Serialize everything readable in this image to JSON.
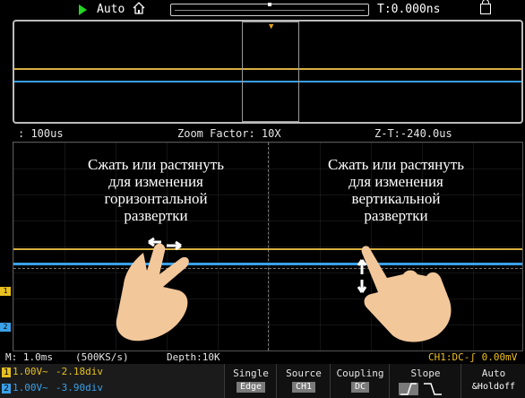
{
  "top_bar": {
    "mode": "Auto",
    "trigger_time": "T:0.000ns"
  },
  "zoom_info": {
    "left": ": 100us",
    "factor": "Zoom Factor: 10X",
    "ztime": "Z-T:-240.0us"
  },
  "hints": {
    "left": [
      "Сжать или растянуть",
      "для изменения",
      "горизонтальной",
      "развертки"
    ],
    "right": [
      "Сжать или растянуть",
      "для изменения",
      "вертикальной",
      "развертки"
    ]
  },
  "status": {
    "time": "M: 1.0ms",
    "rate": "(500KS/s)",
    "depth": "Depth:10K",
    "trigger": "CH1:DC-ʃ 0.00mV"
  },
  "channels": [
    {
      "num": "1",
      "volt": "1.00V~",
      "pos": "-2.18div"
    },
    {
      "num": "2",
      "volt": "1.00V~",
      "pos": "-3.90div"
    }
  ],
  "softkeys": {
    "single": {
      "label": "Single",
      "value": "Edge"
    },
    "source": {
      "label": "Source",
      "value": "CH1"
    },
    "coupling": {
      "label": "Coupling",
      "value": "DC"
    },
    "slope": {
      "label": "Slope"
    },
    "auto": {
      "label": "Auto",
      "value": "&Holdoff"
    }
  },
  "colors": {
    "ch1": "#e6c020",
    "ch2": "#3aa0e8",
    "run": "#23d723"
  },
  "icons": [
    "run-icon",
    "home-icon",
    "lock-icon",
    "slope-icon",
    "hand-pinch-icon"
  ]
}
